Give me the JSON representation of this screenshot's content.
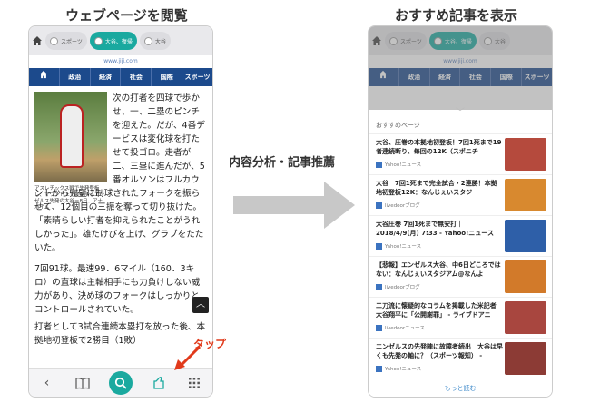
{
  "left_caption": "ウェブページを閲覧",
  "right_caption": "おすすめ記事を表示",
  "middle_label": "内容分析・記事推薦",
  "tap_label": "タップ",
  "browser": {
    "tabs": [
      "スポーツ",
      "大谷、復帰",
      "大谷"
    ],
    "url": "www.jiji.com",
    "nav": [
      "政治",
      "経済",
      "社会",
      "国際",
      "スポーツ"
    ]
  },
  "article": {
    "photo_caption": "アスレチックス戦で先発登板し、マウンド上で躍動するエンゼルス先発の大谷＝8日、アナハイム",
    "p1": "次の打者を四球で歩かせ、一、二塁のピンチを迎えた。だが、4番デービスは変化球を打たせて投ゴロ。走者が二、三塁に進んだが、5番オルソンはフルカウントから完璧に制球されたフォークを振らせて、12個目の三振を奪って切り抜けた。「素晴らしい打者を抑えられたことがうれしかった」。雄たけびを上げ、グラブをたたいた。",
    "p2": "7回91球。最速99．6マイル（160．3キロ）の直球は主軸相手にも力負けしない威力があり、決め球のフォークはしっかりとコントロールされていた。",
    "p3": "打者として3試合連続本塁打を放った後、本拠地初登板で2勝目（1敗）"
  },
  "recommend": {
    "header": "おすすめページ",
    "more": "もっと読む",
    "items": [
      {
        "title": "大谷、圧巻の本拠地初登板！7回1死まで19者連続断り、毎回の12K（スポニチ",
        "source": "Yahoo!ニュース",
        "thumb_color": "#b54a3d"
      },
      {
        "title": "大谷　7回1死まで完全試合・2連勝！本拠地初登板12K：なんじぇいスタジ",
        "source": "livedoorブログ",
        "thumb_color": "#d8892f"
      },
      {
        "title": "大谷圧巻 7回1死まで無安打｜2018/4/9(月) 7:33 - Yahoo!ニュース",
        "source": "Yahoo!ニュース",
        "thumb_color": "#2e5fa8"
      },
      {
        "title": "【悲報】エンゼルス大谷、中6日どころではない：なんじぇいスタジアム@なんよ",
        "source": "livedoorブログ",
        "thumb_color": "#d27a2a"
      },
      {
        "title": "二刀流に懐疑的なコラムを掲載した米記者 大谷翔平に「公開謝罪」 - ライブドアニ",
        "source": "livedoorニュース",
        "thumb_color": "#a8463f"
      },
      {
        "title": "エンゼルスの先発陣に故障者続出　大谷は早くも先発の軸に？（スポーツ報知） -",
        "source": "Yahoo!ニュース",
        "thumb_color": "#8c3b35"
      }
    ]
  },
  "icons": {
    "home": "home-icon",
    "back": "back-icon",
    "book": "book-icon",
    "search": "search-icon",
    "recommend": "recommend-icon",
    "grid": "grid-icon",
    "up": "scroll-up-icon"
  }
}
